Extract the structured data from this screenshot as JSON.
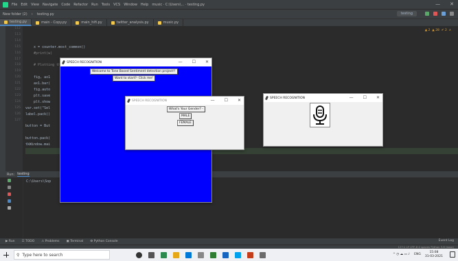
{
  "ide": {
    "menu": [
      "File",
      "Edit",
      "View",
      "Navigate",
      "Code",
      "Refactor",
      "Run",
      "Tools",
      "VCS",
      "Window",
      "Help",
      "music · C:\\Users\\... · testing.py"
    ],
    "nav": [
      "New folder (2)",
      "testing.py"
    ],
    "run_config": "testing",
    "tabs": [
      "testing.py",
      "main - Copy.py",
      "main_hifi.py",
      "twitter_analysis.py",
      "music.py"
    ],
    "inspection": "▲ 2  ▲ 28  ✔ 2  ∧",
    "gutter": [
      "112",
      "113",
      "114",
      "115",
      "116",
      "117",
      "118",
      "119",
      "120",
      "121",
      "122",
      "123",
      "124",
      "125",
      "126",
      "127"
    ],
    "code": [
      "    x = counter.most_common()",
      "    #print(w)",
      "",
      "    # Plotting the emotions on the graph",
      "",
      "    fig, ax1",
      "    ax1.bar(",
      "    fig.auto",
      "    plt.save",
      "    plt.show",
      "var.set(\"Sel",
      "label.pack()",
      "",
      "button = But",
      "",
      "button.pack(",
      "tkWindow.mai",
      ""
    ],
    "run_panel": {
      "tabs": [
        "Run:",
        "testing"
      ],
      "output": "C:\\Users\\Sop"
    },
    "bottom_tabs": [
      "▶ Run",
      "☰ TODO",
      "⚠ Problems",
      "▣ Terminal",
      "⚙ Python Console"
    ],
    "event_log": "Event Log",
    "status": "127:1  LF  UTF-8  4 spaces  Python 3.8 (base)"
  },
  "windows": {
    "blue": {
      "title": "SPEECH RECOGNITION",
      "welcome": "Welcome to Tone Based Sentiment detection project!!",
      "start": "Want to start?- Click me!"
    },
    "gender": {
      "title": "SPEECH RECOGNITION",
      "question": "What's Your Gender? -",
      "male": "MALE",
      "female": "FEMALE"
    },
    "mic": {
      "title": "SPEECH RECOGNITION"
    },
    "ctl": {
      "min": "—",
      "max": "☐",
      "close": "✕"
    }
  },
  "taskbar": {
    "search": "Type here to search",
    "lang": "ENG",
    "time": "15:08",
    "date": "31-03-2021"
  },
  "colors": {
    "blue_window": "#0000ff",
    "editor_bg": "#2b2b2b"
  }
}
